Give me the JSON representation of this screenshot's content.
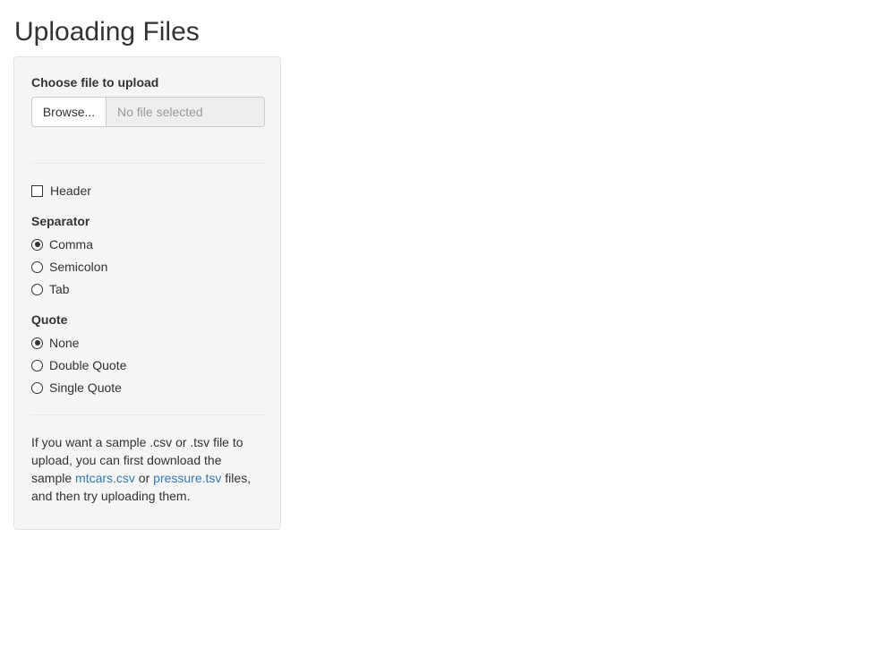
{
  "page": {
    "title": "Uploading Files"
  },
  "file_input": {
    "label": "Choose file to upload",
    "browse_label": "Browse...",
    "file_name_placeholder": "No file selected"
  },
  "header_checkbox": {
    "label": "Header",
    "checked": false
  },
  "separator": {
    "label": "Separator",
    "options": [
      {
        "label": "Comma",
        "checked": true
      },
      {
        "label": "Semicolon",
        "checked": false
      },
      {
        "label": "Tab",
        "checked": false
      }
    ]
  },
  "quote": {
    "label": "Quote",
    "options": [
      {
        "label": "None",
        "checked": true
      },
      {
        "label": "Double Quote",
        "checked": false
      },
      {
        "label": "Single Quote",
        "checked": false
      }
    ]
  },
  "help": {
    "text_1": "If you want a sample .csv or .tsv file to upload, you can first download the sample ",
    "link_1": "mtcars.csv",
    "text_2": " or ",
    "link_2": "pressure.tsv",
    "text_3": " files, and then try uploading them."
  },
  "colors": {
    "panel_bg": "#f5f5f5",
    "link": "#337ab7",
    "text": "#333333"
  }
}
